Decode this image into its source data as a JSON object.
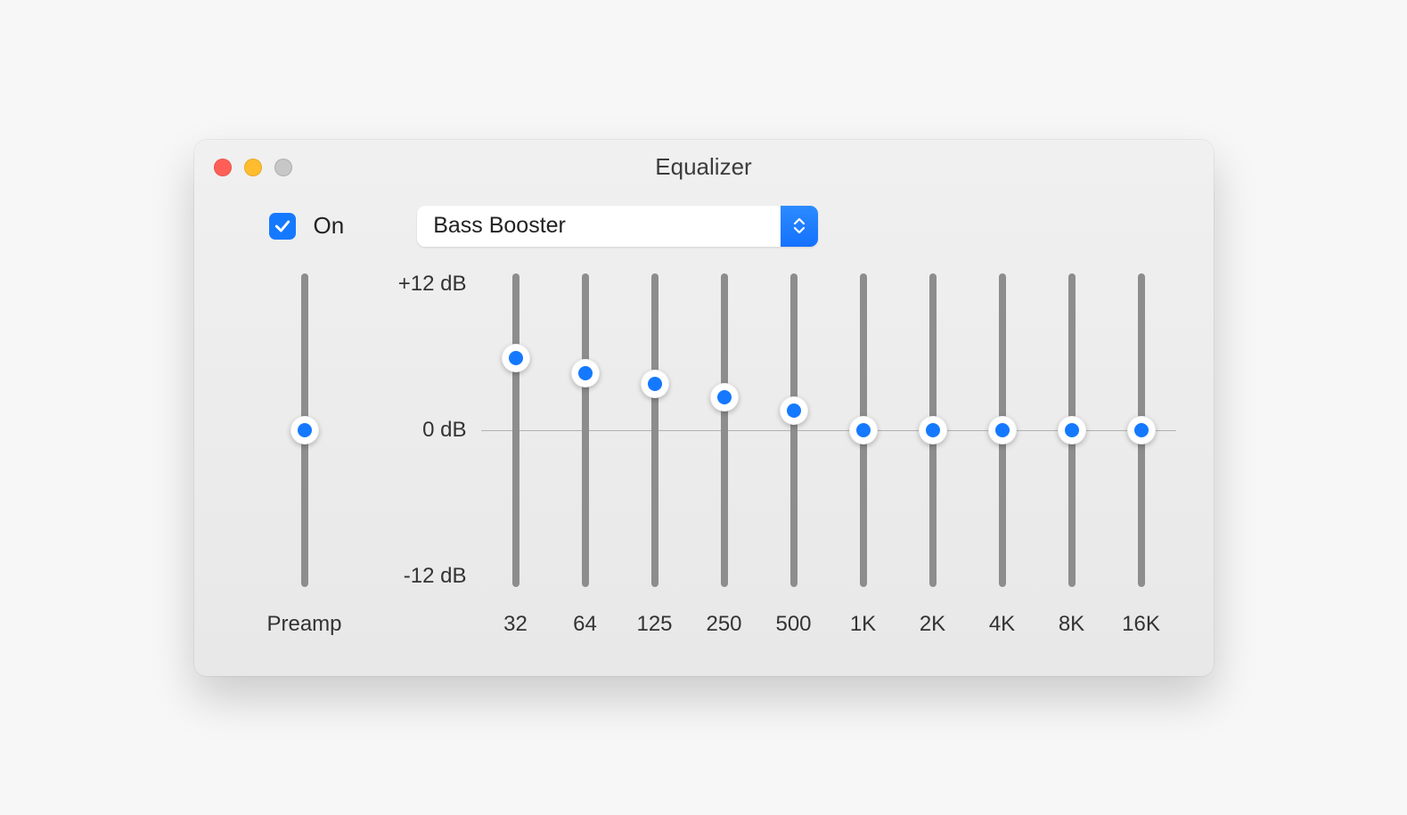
{
  "window": {
    "title": "Equalizer"
  },
  "controls": {
    "on_checkbox": {
      "checked": true,
      "label": "On"
    },
    "preset": {
      "selected": "Bass Booster"
    }
  },
  "db_scale": {
    "max_label": "+12 dB",
    "mid_label": "0 dB",
    "min_label": "-12 dB",
    "min": -12,
    "max": 12
  },
  "preamp": {
    "label": "Preamp",
    "value_db": 0
  },
  "bands": [
    {
      "freq_label": "32",
      "value_db": 5.5
    },
    {
      "freq_label": "64",
      "value_db": 4.3
    },
    {
      "freq_label": "125",
      "value_db": 3.5
    },
    {
      "freq_label": "250",
      "value_db": 2.5
    },
    {
      "freq_label": "500",
      "value_db": 1.5
    },
    {
      "freq_label": "1K",
      "value_db": 0
    },
    {
      "freq_label": "2K",
      "value_db": 0
    },
    {
      "freq_label": "4K",
      "value_db": 0
    },
    {
      "freq_label": "8K",
      "value_db": 0
    },
    {
      "freq_label": "16K",
      "value_db": 0
    }
  ],
  "colors": {
    "accent": "#1579ff",
    "window_bg": "#ececec",
    "slider_track": "#8d8d8d"
  }
}
